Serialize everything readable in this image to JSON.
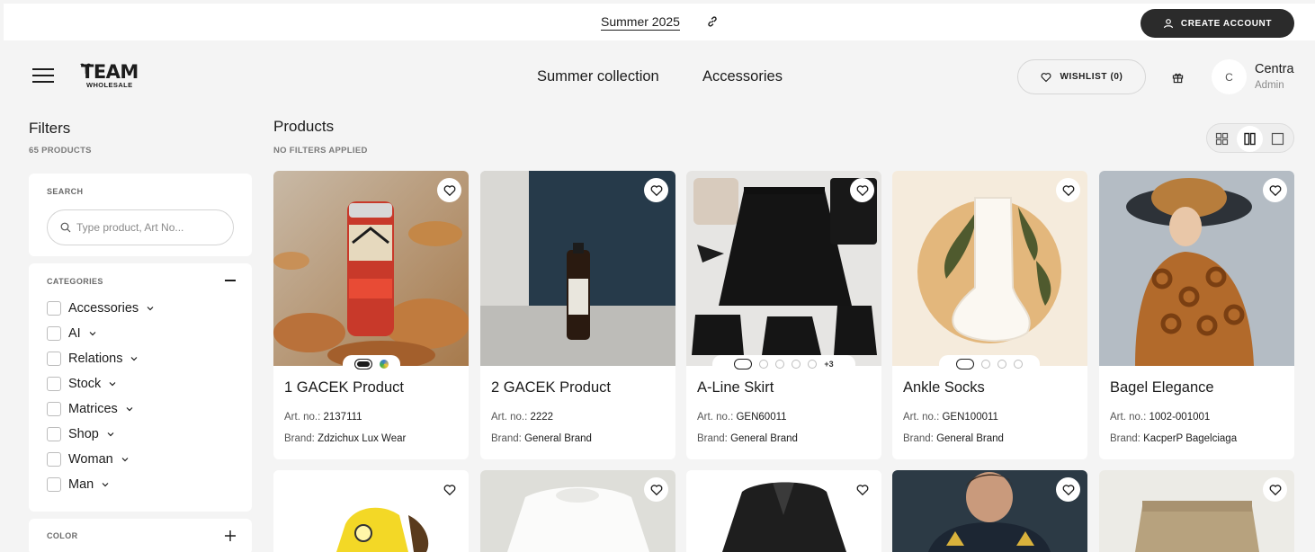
{
  "topbar": {
    "title": "Summer 2025",
    "create_account": "CREATE ACCOUNT"
  },
  "header": {
    "logo_main": "TEAM",
    "logo_sub": "WHOLESALE",
    "nav": [
      "Summer collection",
      "Accessories"
    ],
    "wishlist": "WISHLIST (0)",
    "avatar_initial": "C",
    "user_name": "Centra",
    "user_role": "Admin"
  },
  "filters": {
    "title": "Filters",
    "count": "65 PRODUCTS",
    "search_label": "SEARCH",
    "search_placeholder": "Type product, Art No...",
    "categories_label": "CATEGORIES",
    "categories": [
      "Accessories",
      "AI",
      "Relations",
      "Stock",
      "Matrices",
      "Shop",
      "Woman",
      "Man"
    ],
    "color_label": "COLOR"
  },
  "products": {
    "title": "Products",
    "subtitle": "NO FILTERS APPLIED",
    "items": [
      {
        "name": "1 GACEK Product",
        "art_label": "Art. no.:",
        "art_no": "2137111",
        "brand_label": "Brand:",
        "brand": "Zdzichux Lux Wear"
      },
      {
        "name": "2 GACEK Product",
        "art_label": "Art. no.:",
        "art_no": "2222",
        "brand_label": "Brand:",
        "brand": "General Brand"
      },
      {
        "name": "A-Line Skirt",
        "art_label": "Art. no.:",
        "art_no": "GEN60011",
        "brand_label": "Brand:",
        "brand": "General Brand",
        "more_variants": "+3"
      },
      {
        "name": "Ankle Socks",
        "art_label": "Art. no.:",
        "art_no": "GEN100011",
        "brand_label": "Brand:",
        "brand": "General Brand"
      },
      {
        "name": "Bagel Elegance",
        "art_label": "Art. no.:",
        "art_no": "1002-001001",
        "brand_label": "Brand:",
        "brand": "KacperP Bagelciaga"
      }
    ]
  },
  "icons": [
    "link-icon",
    "user-icon",
    "menu-icon",
    "heart-icon",
    "gift-icon",
    "search-icon",
    "chevron-down-icon",
    "plus-icon",
    "minus-icon",
    "grid-4-icon",
    "grid-2-icon",
    "grid-1-icon"
  ],
  "colors": {
    "accent_dark": "#2b2b2b",
    "background": "#f4f4f4",
    "card": "#ffffff"
  }
}
